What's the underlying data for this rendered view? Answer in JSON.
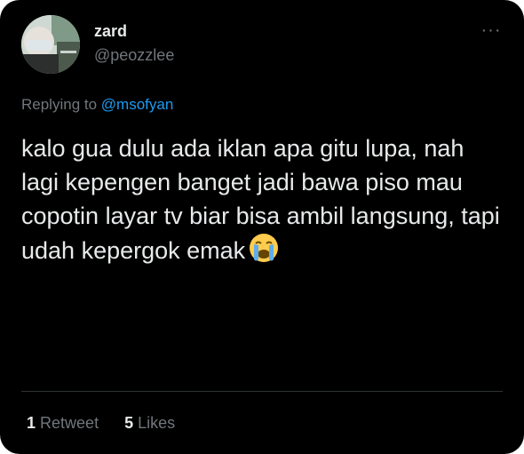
{
  "author": {
    "name": "zard",
    "handle": "@peozzlee"
  },
  "reply": {
    "prefix": "Replying to",
    "mention": "@msofyan"
  },
  "tweet": {
    "text": "kalo gua dulu ada iklan apa gitu lupa, nah lagi kepengen banget jadi bawa piso mau copotin layar tv biar bisa ambil langsung, tapi udah kepergok emak",
    "emoji": "loudly-crying-face"
  },
  "stats": {
    "retweets": "1",
    "retweets_label": "Retweet",
    "likes": "5",
    "likes_label": "Likes"
  },
  "menu": {
    "more_label": "···"
  },
  "colors": {
    "background": "#000000",
    "text": "#e7e9ea",
    "secondary": "#71767b",
    "accent": "#1d9bf0"
  }
}
